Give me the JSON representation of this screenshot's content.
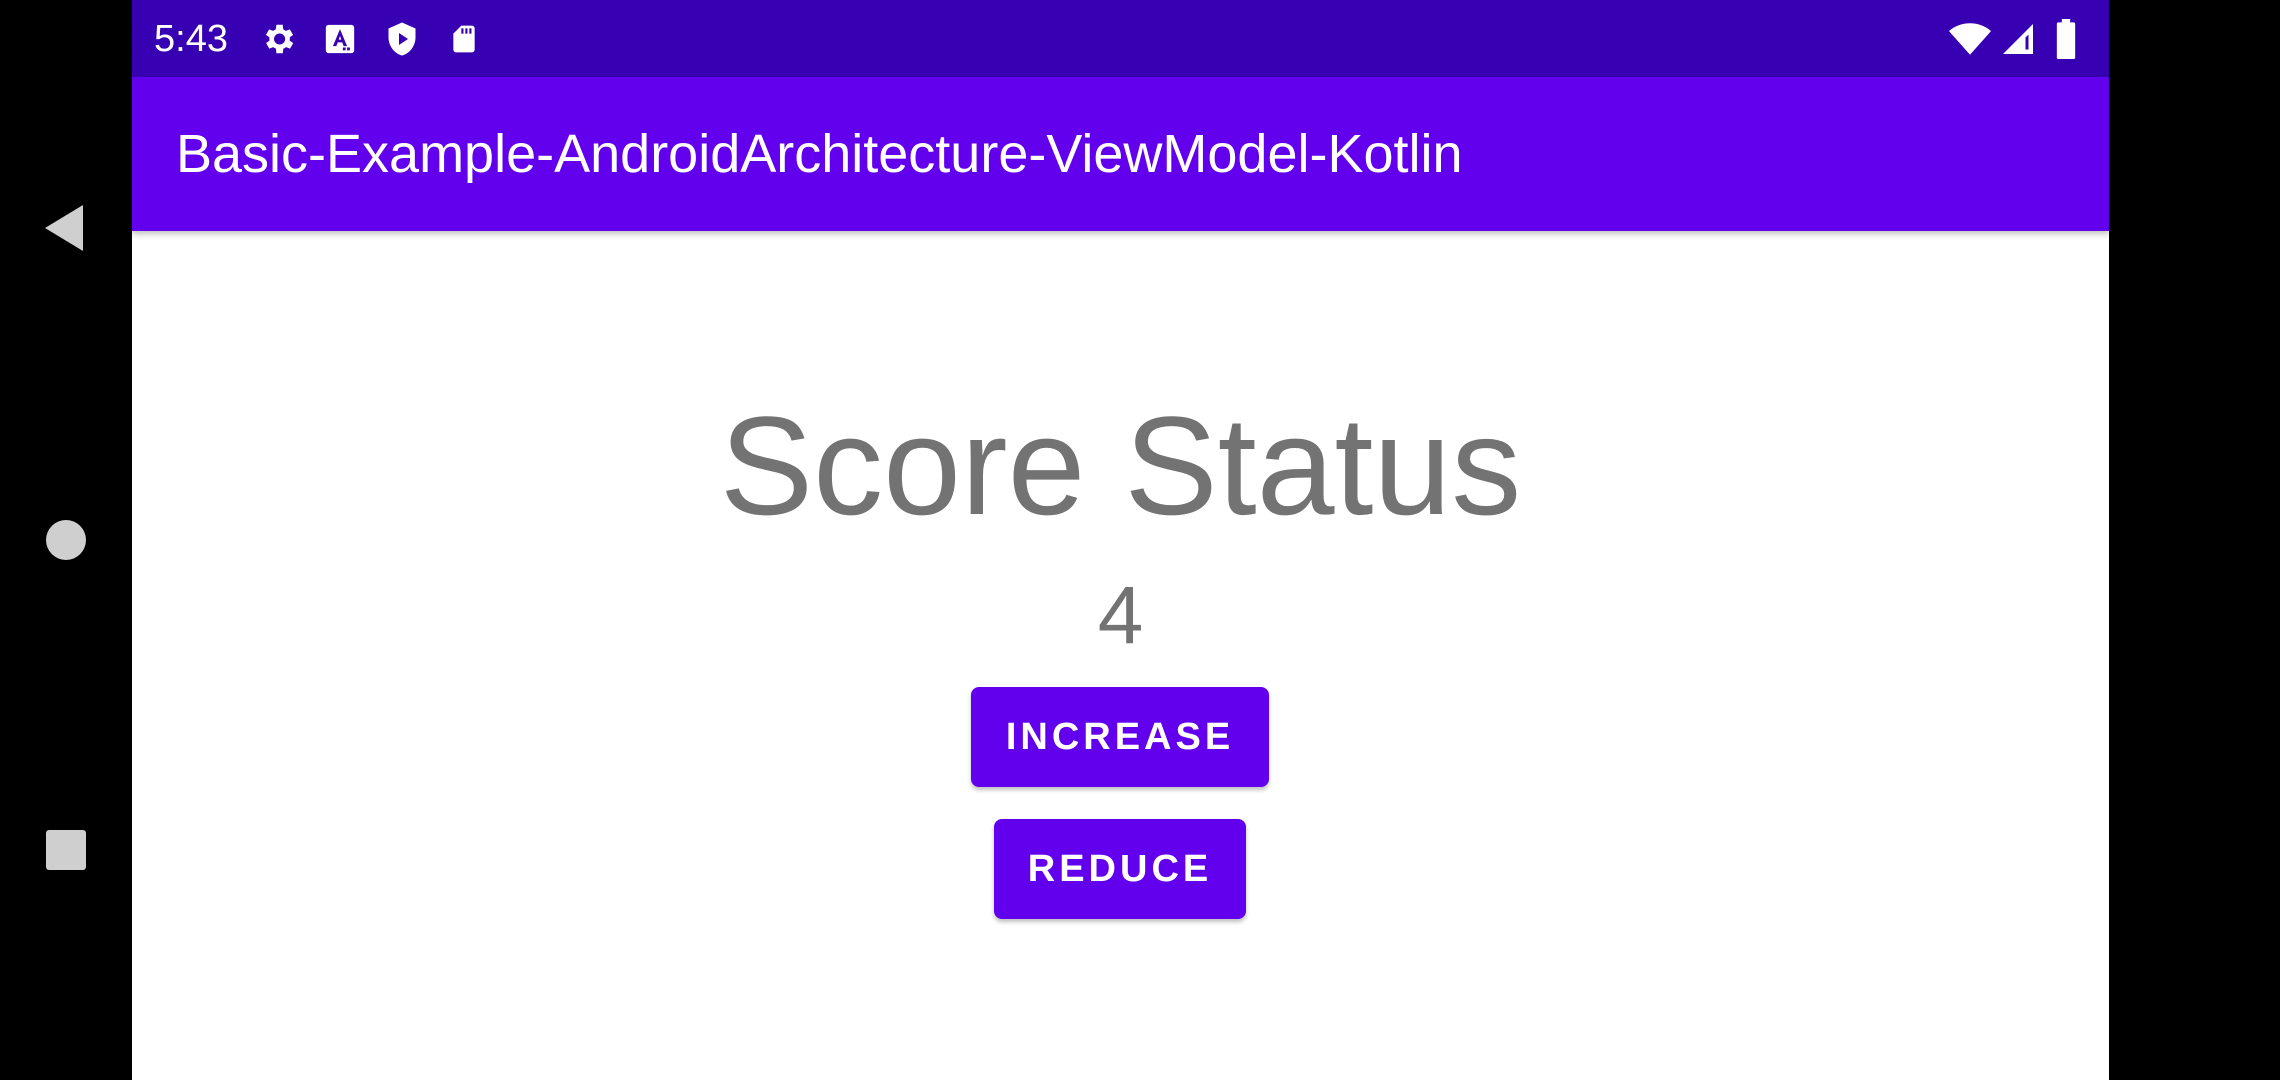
{
  "status_bar": {
    "time": "5:43",
    "left_icons": [
      "gear-icon",
      "font-a-icon",
      "play-protect-icon",
      "sd-card-icon"
    ],
    "right_icons": [
      "wifi-icon",
      "cell-signal-icon",
      "battery-icon"
    ],
    "background": "#3700B3"
  },
  "toolbar": {
    "title": "Basic-Example-AndroidArchitecture-ViewModel-Kotlin",
    "background": "#6200EE"
  },
  "main": {
    "heading": "Score Status",
    "score": "4",
    "increase_label": "INCREASE",
    "reduce_label": "REDUCE",
    "accent": "#6200EE",
    "text_color": "#737373"
  },
  "nav_bar": {
    "buttons": [
      "back-icon",
      "home-icon",
      "recents-icon"
    ]
  }
}
